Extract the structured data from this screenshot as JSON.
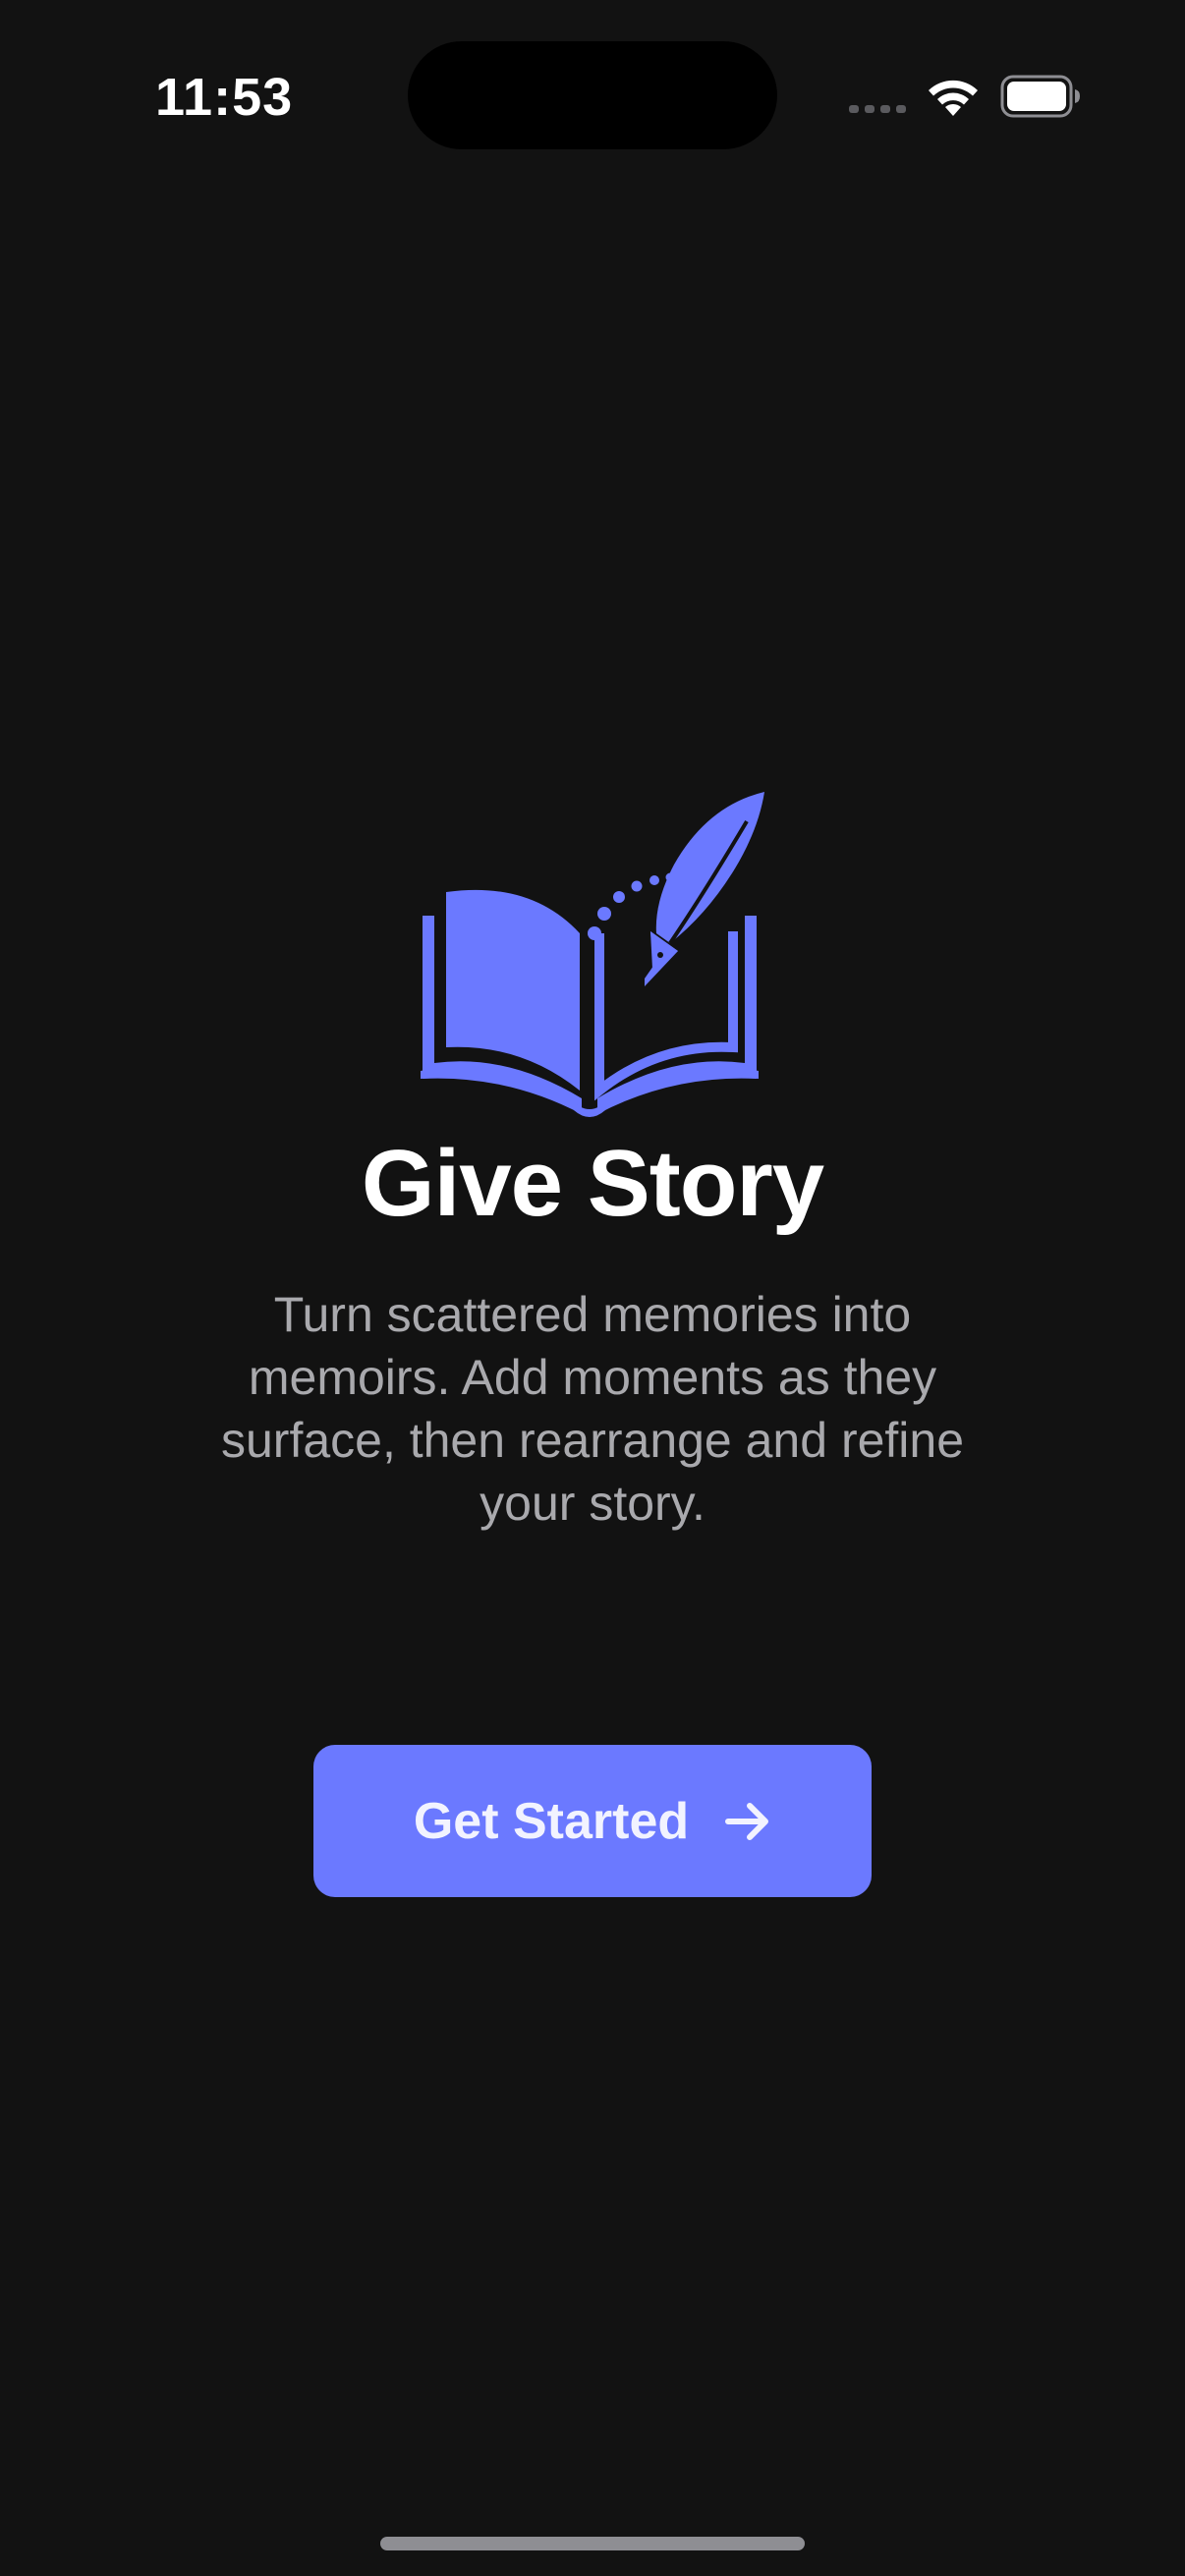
{
  "status_bar": {
    "time": "11:53",
    "icons": [
      "signal-icon",
      "wifi-icon",
      "battery-icon"
    ]
  },
  "app": {
    "logo_icon": "book-quill-icon",
    "title": "Give Story",
    "tagline": "Turn scattered memories into memoirs. Add moments as they surface, then rearrange and refine your story."
  },
  "cta": {
    "label": "Get Started",
    "icon": "arrow-right-icon"
  },
  "colors": {
    "background": "#121212",
    "accent": "#6b79ff",
    "title_text": "#ffffff",
    "secondary_text": "#a9a9ad"
  }
}
